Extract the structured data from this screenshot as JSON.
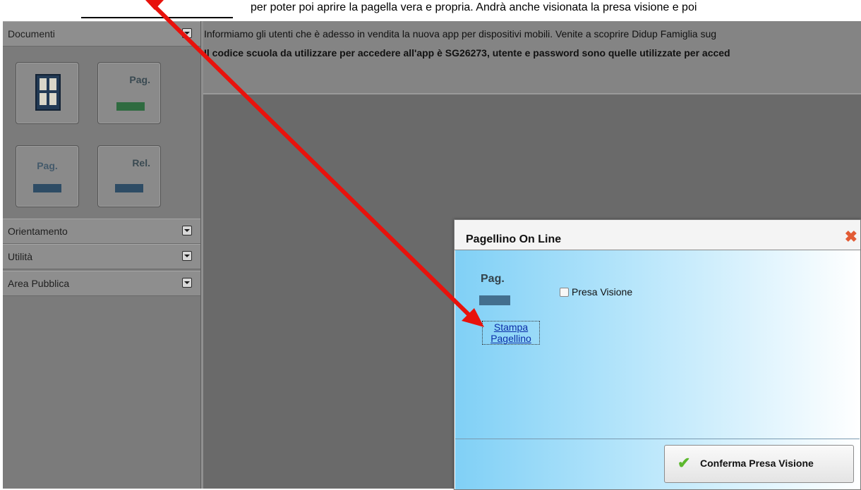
{
  "top_strip": {
    "partial_text": "per poter poi aprire la pagella vera e propria. Andrà anche visionata la presa visione e poi"
  },
  "sidebar": {
    "sections": [
      {
        "label": "Documenti"
      },
      {
        "label": "Orientamento"
      },
      {
        "label": "Utilità"
      },
      {
        "label": "Area Pubblica"
      }
    ],
    "tiles": [
      {
        "caption": "",
        "icon": "bacheca-grid-icon"
      },
      {
        "caption": "Pag.",
        "icon": "pagella-green-icon"
      },
      {
        "caption": "Pag.",
        "icon": "pagellino-icon"
      },
      {
        "caption": "Rel.",
        "icon": "relazione-icon"
      }
    ]
  },
  "notice": {
    "line1": "Informiamo gli utenti che è adesso in vendita la nuova app per dispositivi mobili. Venite a scoprire Didup Famiglia sug",
    "line2": "Il codice scuola da utilizzare per accedere all'app è SG26273, utente e password sono quelle utilizzate per acced"
  },
  "dialog": {
    "title": "Pagellino On Line",
    "icon_caption": "Pag.",
    "link_text": "Stampa Pagellino",
    "checkbox_label": "Presa Visione",
    "checkbox_checked": false,
    "confirm_label": "Conferma Presa Visione",
    "close_color": "#e25b35"
  },
  "annotation": {
    "arrow_color": "#e8120c"
  }
}
